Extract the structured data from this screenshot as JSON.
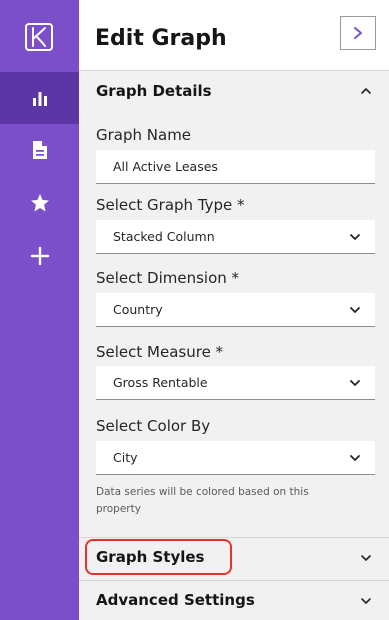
{
  "sidebar": {
    "logo_icon": "k-logo-icon",
    "items": [
      {
        "icon": "bar-chart-icon",
        "active": true
      },
      {
        "icon": "document-icon",
        "active": false
      },
      {
        "icon": "star-icon",
        "active": false
      },
      {
        "icon": "plus-icon",
        "active": false
      }
    ],
    "color": "#7a4fc9",
    "active_color": "#5d36a6"
  },
  "header": {
    "title": "Edit Graph",
    "collapse_icon": "chevron-right-icon"
  },
  "sections": {
    "details": {
      "title": "Graph Details",
      "expanded": true
    },
    "styles": {
      "title": "Graph Styles",
      "expanded": false,
      "highlight_color": "#e4332c"
    },
    "advanced": {
      "title": "Advanced Settings",
      "expanded": false
    }
  },
  "fields": {
    "name": {
      "label": "Graph Name",
      "value": "All Active Leases"
    },
    "type": {
      "label": "Select Graph Type *",
      "value": "Stacked Column"
    },
    "dimension": {
      "label": "Select Dimension  *",
      "value": "Country"
    },
    "measure": {
      "label": "Select Measure  *",
      "value": "Gross Rentable"
    },
    "color_by": {
      "label": "Select Color By",
      "value": "City",
      "helper": "Data series will be colored based on this property"
    }
  }
}
